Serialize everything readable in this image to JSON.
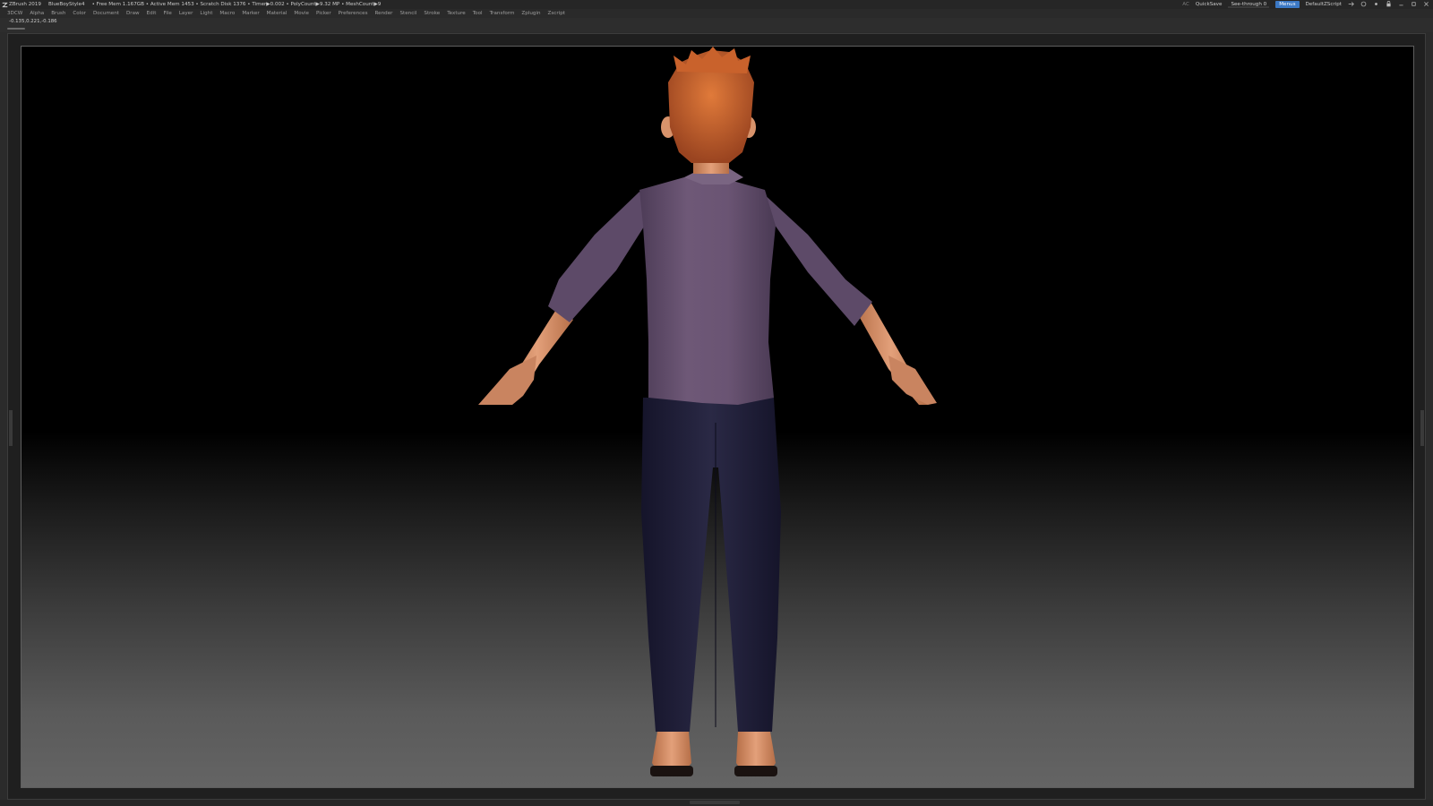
{
  "titlebar": {
    "app": "ZBrush 2019",
    "ui_style": "BlueBoyStyle4",
    "stats": "• Free Mem 1.167GB • Active Mem 1453 • Scratch Disk 1376 • Timer▶0.002 • PolyCount▶9.32 MP • MeshCount▶9",
    "ac_label": "AC",
    "quicksave": "QuickSave",
    "see_through": "See-through 0",
    "see_through_value": 0,
    "menus": "Menus",
    "script": "DefaultZScript"
  },
  "menubar": {
    "items": [
      "3DCW",
      "Alpha",
      "Brush",
      "Color",
      "Document",
      "Draw",
      "Edit",
      "File",
      "Layer",
      "Light",
      "Macro",
      "Marker",
      "Material",
      "Movie",
      "Picker",
      "Preferences",
      "Render",
      "Stencil",
      "Stroke",
      "Texture",
      "Tool",
      "Transform",
      "Zplugin",
      "Zscript"
    ]
  },
  "infoline": {
    "coords": "-0.135,0.221,-0.186"
  },
  "colors": {
    "accent": "#3b78c4",
    "shirt": "#6e5877",
    "pants": "#22213a",
    "skin": "#d9946a",
    "hair": "#c9622c"
  }
}
